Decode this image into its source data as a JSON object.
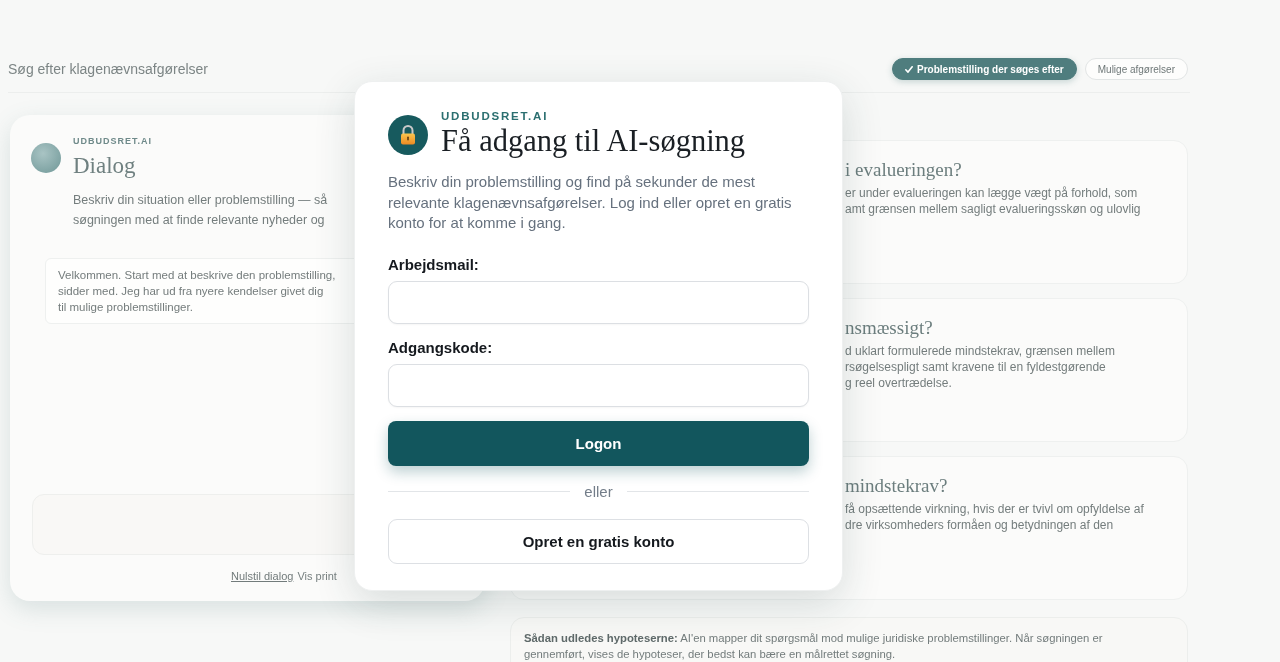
{
  "search_bar": {
    "title": "Søg efter klagenævnsafgørelser"
  },
  "view_tabs": [
    {
      "label": "Problemstilling der søges efter",
      "selected": true
    },
    {
      "label": "Mulige afgørelser",
      "selected": false
    }
  ],
  "dialog_panel": {
    "brand": "UDBUDSRET.AI",
    "title": "Dialog",
    "description_lines": [
      "Beskriv din situation eller problemstilling — så",
      "søgningen med at finde relevante nyheder og"
    ],
    "message_lines": [
      "Velkommen. Start med at beskrive den problemstilling,",
      "sidder med. Jeg har ud fra nyere kendelser givet dig",
      "til mulige problemstillinger."
    ],
    "footer_link": "Nulstil dialog",
    "footer_text": "Vis print"
  },
  "hypothesis_cards": [
    {
      "title": "i evalueringen?",
      "lines": [
        "er under evalueringen kan lægge vægt på forhold, som",
        "amt grænsen mellem sagligt evalueringsskøn og ulovlig"
      ]
    },
    {
      "title": "nsmæssigt?",
      "lines": [
        "d uklart formulerede mindstekrav, grænsen mellem",
        "rsøgelsespligt samt kravene til en fyldestgørende",
        "g reel overtrædelse."
      ]
    },
    {
      "title": "mindstekrav?",
      "lines": [
        "få opsættende virkning, hvis der er tvivl om opfyldelse af",
        "dre virksomheders formåen og betydningen af den"
      ]
    }
  ],
  "info_note": "**Sådan udledes hypoteserne:** AI'en mapper dit spørgsmål mod mulige juridiske problemstillinger. Når søgningen er gennemført, vises de hypoteser, der bedst kan bære en målrettet søgning.",
  "login_modal": {
    "brand": "UDBUDSRET.AI",
    "title": "Få adgang til AI-søgning",
    "description": "Beskriv din problemstilling og find på sekunder de mest relevante klagenævnsafgørelser. Log ind eller opret en gratis konto for at komme i gang.",
    "fields": [
      {
        "label": "Arbejdsmail:"
      },
      {
        "label": "Adgangskode:"
      }
    ],
    "primary_button": "Logon",
    "divider": "eller",
    "secondary_button": "Opret en gratis konto"
  }
}
